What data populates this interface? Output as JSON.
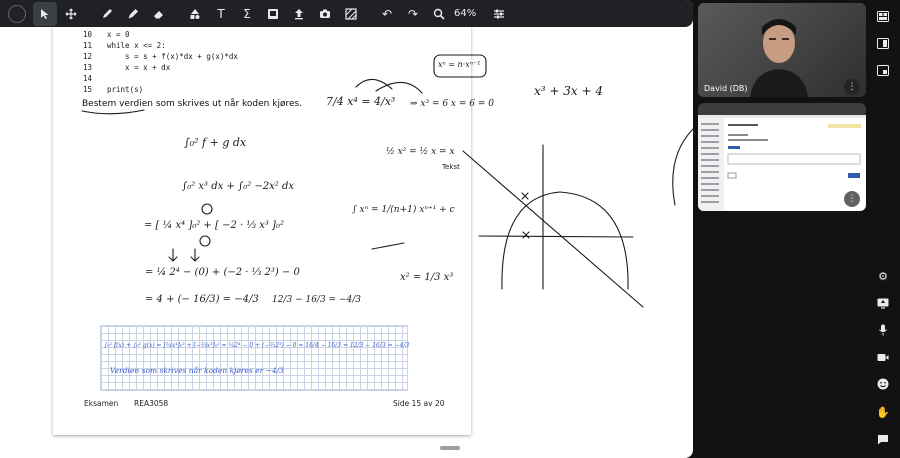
{
  "toolbar": {
    "zoom_label": "64%",
    "tools": [
      "select-arrow",
      "move-cross",
      "pen",
      "marker",
      "eraser",
      "shapes",
      "text",
      "math-sigma",
      "image",
      "upload",
      "camera",
      "pattern"
    ],
    "undo": "undo",
    "redo": "redo",
    "settings": "sliders"
  },
  "document": {
    "code_lines": [
      {
        "num": "10",
        "text": "x = 0"
      },
      {
        "num": "11",
        "text": "while x <= 2:"
      },
      {
        "num": "12",
        "text": "    s = s + f(x)*dx + g(x)*dx"
      },
      {
        "num": "13",
        "text": "    x = x + dx"
      },
      {
        "num": "14",
        "text": ""
      },
      {
        "num": "15",
        "text": "print(s)"
      }
    ],
    "task_text": "Bestem verdien som skrives ut når koden kjøres.",
    "footer_left": "Eksamen",
    "footer_course": "REA3058",
    "footer_right": "Side 15 av 20"
  },
  "annotations": {
    "text_label": "Tekst",
    "expr_cubic": "x³ + 3x + 4",
    "expr_power_rule": "xⁿ = n·xⁿ⁻¹",
    "expr_integral_fg": "∫₀² f + g dx",
    "expr_equation": "⇒ x³ = 6   x = 6 = 0",
    "expr_split": "∫₀² x³ dx  +  ∫₀² −2x² dx",
    "expr_bracket": "= [ ¼ x⁴ ]₀²  +  [ −2 · ⅓ x³ ]₀²",
    "expr_step2": "= ¼ 2⁴ − (0)  + (−2 · ⅓ 2³) − 0",
    "expr_result": "= 4 + (− 16/3) = −4/3",
    "expr_side": "12/3 − 16/3 = −4/3",
    "expr_small": "½ x²  = ½ x = x",
    "expr_integral_rule": "∫ xⁿ = 1/(n+1) xⁿ⁺¹ + c",
    "expr_x2": "x² = 1/3 x³",
    "grid_line1": "∫₀² f(x) + ∫₀² g(x) = [¼x⁴]₀² + [−⅔x³]₀² = ¼2⁴ − 0 + (−⅔2³) − 0 = 16/4 − 16/3 = 12/3 − 16/3 = −4/3",
    "grid_line2": "Verdien som skrives når koden kjøres er −4/3",
    "fraction_top": "7/4 x⁴ = 4/x³"
  },
  "participants": {
    "main_name": "David (DB)",
    "second_tile": "screen-share"
  },
  "side_icons": [
    "layout-grid",
    "pip-layout",
    "pip-window",
    "settings-gear",
    "present-screen",
    "microphone",
    "camera-video",
    "emoji-smile",
    "raise-hand",
    "chat-bubble"
  ],
  "colors": {
    "toolbar_bg": "#202124",
    "panel_bg": "#121212",
    "ink": "#1b1b1b",
    "grid_ink": "#3a5bd1"
  }
}
